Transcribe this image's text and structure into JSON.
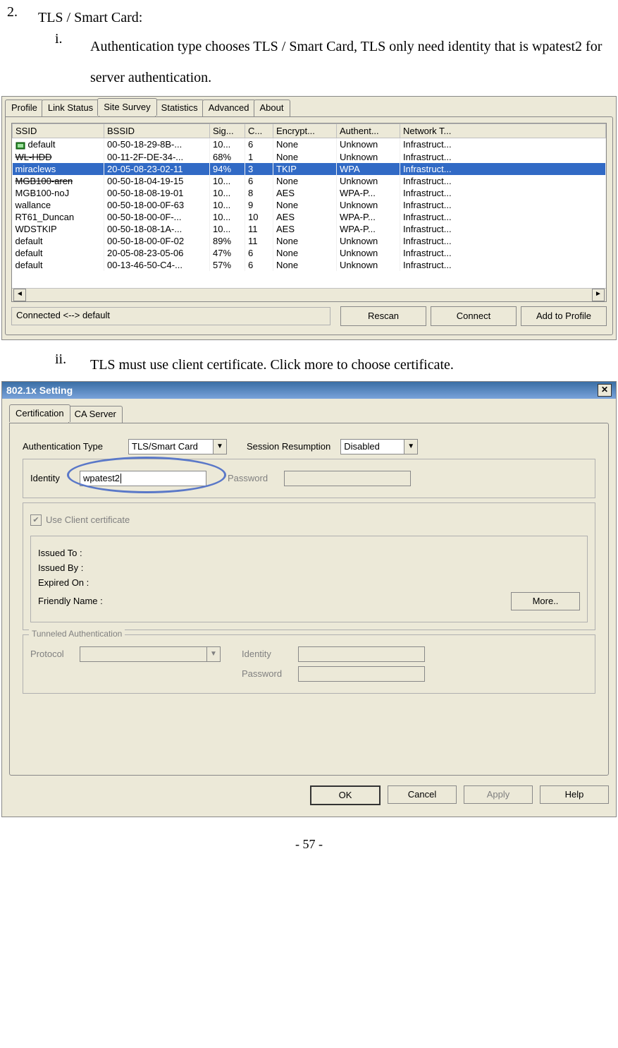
{
  "doc": {
    "item_num": "2.",
    "item_title": "TLS / Smart Card:",
    "sub_i": "i.",
    "sub_i_text": "Authentication type chooses TLS / Smart Card, TLS only need identity that is wpatest2 for server authentication.",
    "sub_ii": "ii.",
    "sub_ii_text": "TLS must use client certificate. Click more to choose certificate.",
    "page_number": "- 57 -"
  },
  "survey": {
    "tabs": [
      "Profile",
      "Link Status",
      "Site Survey",
      "Statistics",
      "Advanced",
      "About"
    ],
    "active_tab_index": 2,
    "headers": [
      "SSID",
      "BSSID",
      "Sig...",
      "C...",
      "Encrypt...",
      "Authent...",
      "Network T..."
    ],
    "rows": [
      {
        "ssid": "default",
        "bssid": "00-50-18-29-8B-...",
        "sig": "10...",
        "ch": "6",
        "enc": "None",
        "auth": "Unknown",
        "net": "Infrastruct...",
        "icon": true,
        "strike": false
      },
      {
        "ssid": "WL-HDD",
        "bssid": "00-11-2F-DE-34-...",
        "sig": "68%",
        "ch": "1",
        "enc": "None",
        "auth": "Unknown",
        "net": "Infrastruct...",
        "icon": false,
        "strike": true
      },
      {
        "ssid": "miraclews",
        "bssid": "20-05-08-23-02-11",
        "sig": "94%",
        "ch": "3",
        "enc": "TKIP",
        "auth": "WPA",
        "net": "Infrastruct...",
        "icon": false,
        "strike": false,
        "selected": true
      },
      {
        "ssid": "MGB100-aren",
        "bssid": "00-50-18-04-19-15",
        "sig": "10...",
        "ch": "6",
        "enc": "None",
        "auth": "Unknown",
        "net": "Infrastruct...",
        "icon": false,
        "strike": true
      },
      {
        "ssid": "MGB100-noJ",
        "bssid": "00-50-18-08-19-01",
        "sig": "10...",
        "ch": "8",
        "enc": "AES",
        "auth": "WPA-P...",
        "net": "Infrastruct...",
        "icon": false,
        "strike": false
      },
      {
        "ssid": "wallance",
        "bssid": "00-50-18-00-0F-63",
        "sig": "10...",
        "ch": "9",
        "enc": "None",
        "auth": "Unknown",
        "net": "Infrastruct...",
        "icon": false,
        "strike": false
      },
      {
        "ssid": "RT61_Duncan",
        "bssid": "00-50-18-00-0F-...",
        "sig": "10...",
        "ch": "10",
        "enc": "AES",
        "auth": "WPA-P...",
        "net": "Infrastruct...",
        "icon": false,
        "strike": false
      },
      {
        "ssid": "WDSTKIP",
        "bssid": "00-50-18-08-1A-...",
        "sig": "10...",
        "ch": "11",
        "enc": "AES",
        "auth": "WPA-P...",
        "net": "Infrastruct...",
        "icon": false,
        "strike": false
      },
      {
        "ssid": "default",
        "bssid": "00-50-18-00-0F-02",
        "sig": "89%",
        "ch": "11",
        "enc": "None",
        "auth": "Unknown",
        "net": "Infrastruct...",
        "icon": false,
        "strike": false
      },
      {
        "ssid": "default",
        "bssid": "20-05-08-23-05-06",
        "sig": "47%",
        "ch": "6",
        "enc": "None",
        "auth": "Unknown",
        "net": "Infrastruct...",
        "icon": false,
        "strike": false
      },
      {
        "ssid": "default",
        "bssid": "00-13-46-50-C4-...",
        "sig": "57%",
        "ch": "6",
        "enc": "None",
        "auth": "Unknown",
        "net": "Infrastruct...",
        "icon": false,
        "strike": false
      }
    ],
    "status_text": "Connected <--> default",
    "buttons": {
      "rescan": "Rescan",
      "connect": "Connect",
      "add": "Add to Profile"
    }
  },
  "dlg": {
    "title": "802.1x Setting",
    "tabs": [
      "Certification",
      "CA Server"
    ],
    "active_tab_index": 0,
    "auth_type_label": "Authentication Type",
    "auth_type_value": "TLS/Smart Card",
    "session_label": "Session Resumption",
    "session_value": "Disabled",
    "identity_label": "Identity",
    "identity_value": "wpatest2",
    "password_label": "Password",
    "use_cert_label": "Use Client certificate",
    "cert": {
      "issued_to": "Issued To :",
      "issued_by": "Issued By :",
      "expired_on": "Expired On :",
      "friendly": "Friendly Name :",
      "more_btn": "More.."
    },
    "tunnel": {
      "title": "Tunneled Authentication",
      "protocol": "Protocol",
      "identity": "Identity",
      "password": "Password"
    },
    "buttons": {
      "ok": "OK",
      "cancel": "Cancel",
      "apply": "Apply",
      "help": "Help"
    }
  }
}
